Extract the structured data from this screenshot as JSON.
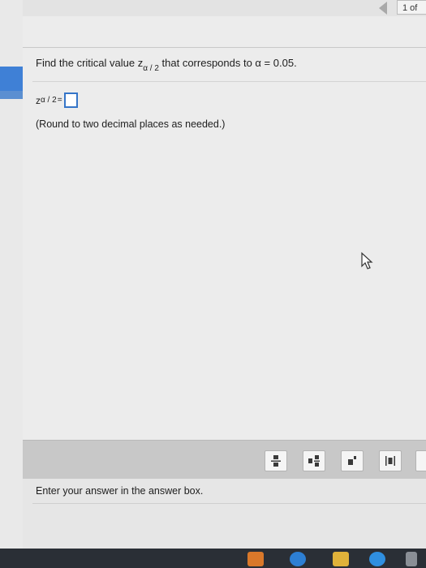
{
  "header": {
    "page_indicator": "1 of"
  },
  "question": {
    "prompt_prefix": "Find the critical value z",
    "prompt_subscript": "α / 2",
    "prompt_middle": " that corresponds to α = 0.05.",
    "answer_label": "z",
    "answer_subscript": "α / 2",
    "answer_equals": "=",
    "answer_value": "",
    "hint": "(Round to two decimal places as needed.)"
  },
  "tools": [
    {
      "name": "fraction-tool-icon"
    },
    {
      "name": "mixed-number-tool-icon"
    },
    {
      "name": "exponent-tool-icon"
    },
    {
      "name": "absolute-value-tool-icon"
    }
  ],
  "status": {
    "message": "Enter your answer in the answer box."
  },
  "taskbar": [
    {
      "name": "outlook-icon",
      "color": "#d9782a"
    },
    {
      "name": "edge-icon",
      "color": "#2d7fd3"
    },
    {
      "name": "file-explorer-icon",
      "color": "#e0b23a"
    },
    {
      "name": "pearson-icon",
      "color": "#2f8fe0"
    }
  ],
  "colors": {
    "accent": "#3575c8",
    "left_accent": "#3f80d6"
  }
}
